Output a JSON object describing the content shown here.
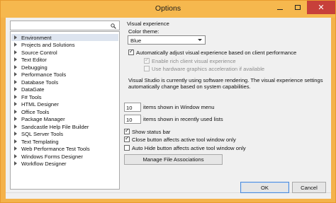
{
  "window": {
    "title": "Options",
    "close_glyph": "✕"
  },
  "sidebar": {
    "search_value": "",
    "items": [
      {
        "label": "Environment"
      },
      {
        "label": "Projects and Solutions"
      },
      {
        "label": "Source Control"
      },
      {
        "label": "Text Editor"
      },
      {
        "label": "Debugging"
      },
      {
        "label": "Performance Tools"
      },
      {
        "label": "Database Tools"
      },
      {
        "label": "DataGate"
      },
      {
        "label": "F# Tools"
      },
      {
        "label": "HTML Designer"
      },
      {
        "label": "Office Tools"
      },
      {
        "label": "Package Manager"
      },
      {
        "label": "Sandcastle Help File Builder"
      },
      {
        "label": "SQL Server Tools"
      },
      {
        "label": "Text Templating"
      },
      {
        "label": "Web Performance Test Tools"
      },
      {
        "label": "Windows Forms Designer"
      },
      {
        "label": "Workflow Designer"
      }
    ],
    "selected": "Environment"
  },
  "visual": {
    "group_title": "Visual experience",
    "theme_label": "Color theme:",
    "theme_value": "Blue",
    "auto_adjust": "Automatically adjust visual experience based on client performance",
    "rich_client": "Enable rich client visual experience",
    "hw_accel": "Use hardware graphics acceleration if available",
    "info_line1": "Visual Studio is currently using software rendering.  The visual experience settings",
    "info_line2": "automatically change based on system capabilities."
  },
  "settings": {
    "window_menu_count": "10",
    "window_menu_label": "items shown in Window menu",
    "recent_count": "10",
    "recent_label": "items shown in recently used lists",
    "status_bar": "Show status bar",
    "close_btn": "Close button affects active tool window only",
    "autohide_btn": "Auto Hide button affects active tool window only",
    "file_assoc_button": "Manage File Associations"
  },
  "checkbox_glyph": "✓",
  "footer": {
    "ok": "OK",
    "cancel": "Cancel"
  }
}
